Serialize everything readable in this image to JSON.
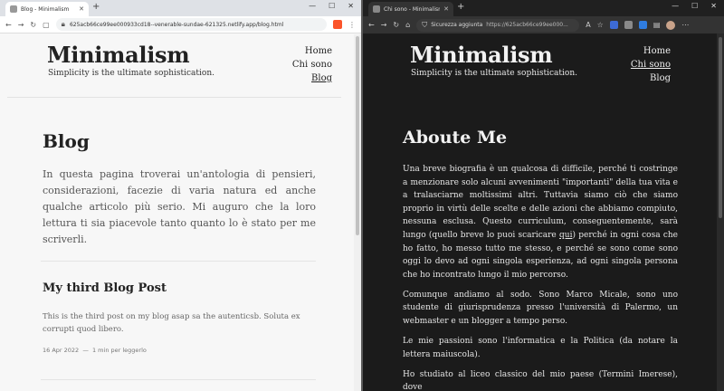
{
  "left_window": {
    "tab_title": "Blog - Minimalism",
    "url": "625acb66ce99ee000933cd18--venerable-sundae-621325.netlify.app/blog.html",
    "site": {
      "brand": "Minimalism",
      "tagline": "Simplicity is the ultimate sophistication.",
      "nav": [
        "Home",
        "Chi sono",
        "Blog"
      ],
      "active_nav": "Blog"
    },
    "page": {
      "title": "Blog",
      "intro": "In questa pagina troverai un'antologia di pensieri, considerazioni, facezie di varia natura ed anche qualche articolo più serio. Mi auguro che la loro lettura ti sia piacevole tanto quanto lo è stato per me scriverli.",
      "post": {
        "title": "My third Blog Post",
        "excerpt": "This is the third post on my blog asap sa the autenticsb. Soluta ex corrupti quod libero.",
        "date": "16 Apr 2022",
        "separator": "—",
        "read_time": "1 min per leggerlo"
      }
    }
  },
  "right_window": {
    "tab_title": "Chi sono - Minimalism",
    "security_label": "Sicurezza aggiunta",
    "url": "https://625acb66ce99ee000...",
    "site": {
      "brand": "Minimalism",
      "tagline": "Simplicity is the ultimate sophistication.",
      "nav": [
        "Home",
        "Chi sono",
        "Blog"
      ],
      "active_nav": "Chi sono"
    },
    "page": {
      "title": "Aboute Me",
      "p1_before": "Una breve biografia è un qualcosa di difficile, perché ti costringe a menzionare solo alcuni avvenimenti \"importanti\" della tua vita e a tralasciarne moltissimi altri. Tuttavia siamo ciò che siamo proprio in virtù delle scelte e delle azioni che abbiamo compiuto, nessuna esclusa. Questo curriculum, conseguentemente, sarà lungo (quello breve lo puoi scaricare ",
      "p1_link": "qui",
      "p1_after": ") perché in ogni cosa che ho fatto, ho messo tutto me stesso, e perché se sono come sono oggi lo devo ad ogni singola esperienza, ad ogni singola persona che ho incontrato lungo il mio percorso.",
      "p2": "Comunque andiamo al sodo. Sono Marco Micale, sono uno studente di giurisprudenza presso l'università di Palermo, un webmaster e un blogger a tempo perso.",
      "p3": "Le mie passioni sono l'informatica e la Politica (da notare la lettera maiuscola).",
      "p4": "Ho studiato al liceo classico del mio paese (Termini Imerese), dove"
    }
  },
  "colors": {
    "left_bg": "#f7f7f7",
    "right_bg": "#1b1b1b",
    "brave_icon": "#fb542b"
  }
}
